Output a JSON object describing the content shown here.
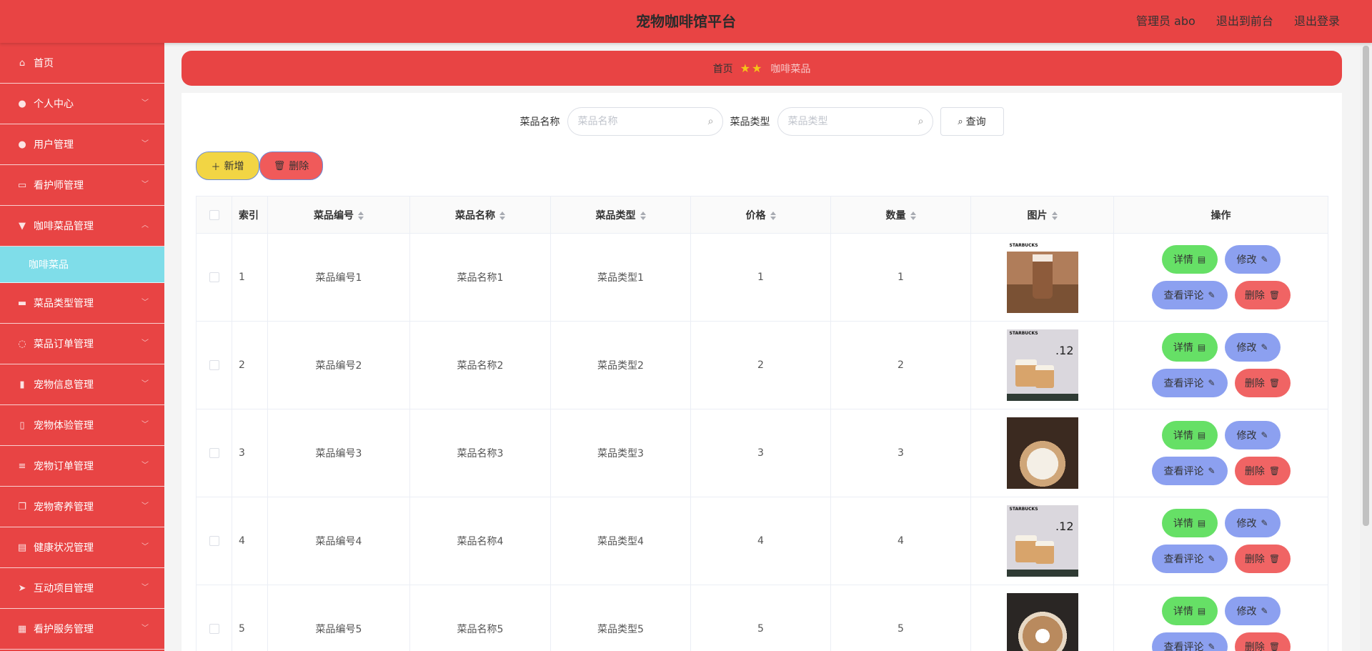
{
  "header": {
    "title": "宠物咖啡馆平台",
    "user": "管理员 abo",
    "to_front": "退出到前台",
    "logout": "退出登录"
  },
  "sidebar": {
    "items": [
      {
        "label": "首页",
        "icon": "home-icon"
      },
      {
        "label": "个人中心",
        "icon": "user-icon"
      },
      {
        "label": "用户管理",
        "icon": "user-icon"
      },
      {
        "label": "看护师管理",
        "icon": "card-icon"
      },
      {
        "label": "咖啡菜品管理",
        "icon": "cup-icon"
      },
      {
        "label": "菜品类型管理",
        "icon": "briefcase-icon"
      },
      {
        "label": "菜品订单管理",
        "icon": "power-icon"
      },
      {
        "label": "宠物信息管理",
        "icon": "bar-chart-icon"
      },
      {
        "label": "宠物体验管理",
        "icon": "phone-icon"
      },
      {
        "label": "宠物订单管理",
        "icon": "list-icon"
      },
      {
        "label": "宠物寄养管理",
        "icon": "copy-icon"
      },
      {
        "label": "健康状况管理",
        "icon": "clipboard-icon"
      },
      {
        "label": "互动项目管理",
        "icon": "send-icon"
      },
      {
        "label": "看护服务管理",
        "icon": "grid-icon"
      }
    ],
    "submenu": "咖啡菜品"
  },
  "breadcrumb": {
    "home": "首页",
    "current": "咖啡菜品"
  },
  "search": {
    "name_label": "菜品名称",
    "name_placeholder": "菜品名称",
    "type_label": "菜品类型",
    "type_placeholder": "菜品类型",
    "query_button": "查询"
  },
  "toolbar": {
    "add": "新增",
    "delete": "删除"
  },
  "table": {
    "headers": {
      "index": "索引",
      "code": "菜品编号",
      "name": "菜品名称",
      "type": "菜品类型",
      "price": "价格",
      "qty": "数量",
      "image": "图片",
      "ops": "操作"
    },
    "rows": [
      {
        "index": "1",
        "code": "菜品编号1",
        "name": "菜品名称1",
        "type": "菜品类型1",
        "price": "1",
        "qty": "1"
      },
      {
        "index": "2",
        "code": "菜品编号2",
        "name": "菜品名称2",
        "type": "菜品类型2",
        "price": "2",
        "qty": "2"
      },
      {
        "index": "3",
        "code": "菜品编号3",
        "name": "菜品名称3",
        "type": "菜品类型3",
        "price": "3",
        "qty": "3"
      },
      {
        "index": "4",
        "code": "菜品编号4",
        "name": "菜品名称4",
        "type": "菜品类型4",
        "price": "4",
        "qty": "4"
      },
      {
        "index": "5",
        "code": "菜品编号5",
        "name": "菜品名称5",
        "type": "菜品类型5",
        "price": "5",
        "qty": "5"
      }
    ],
    "actions": {
      "detail": "详情",
      "edit": "修改",
      "review": "查看评论",
      "delete": "删除"
    },
    "image_text": {
      "brand": "STARBUCKS",
      "promo_num": ".12"
    }
  },
  "colors": {
    "primary": "#e84444",
    "submenu": "#7fdde9",
    "detail": "#66e066",
    "edit": "#8ca0f0",
    "delete": "#f06464",
    "add": "#f2d544"
  }
}
